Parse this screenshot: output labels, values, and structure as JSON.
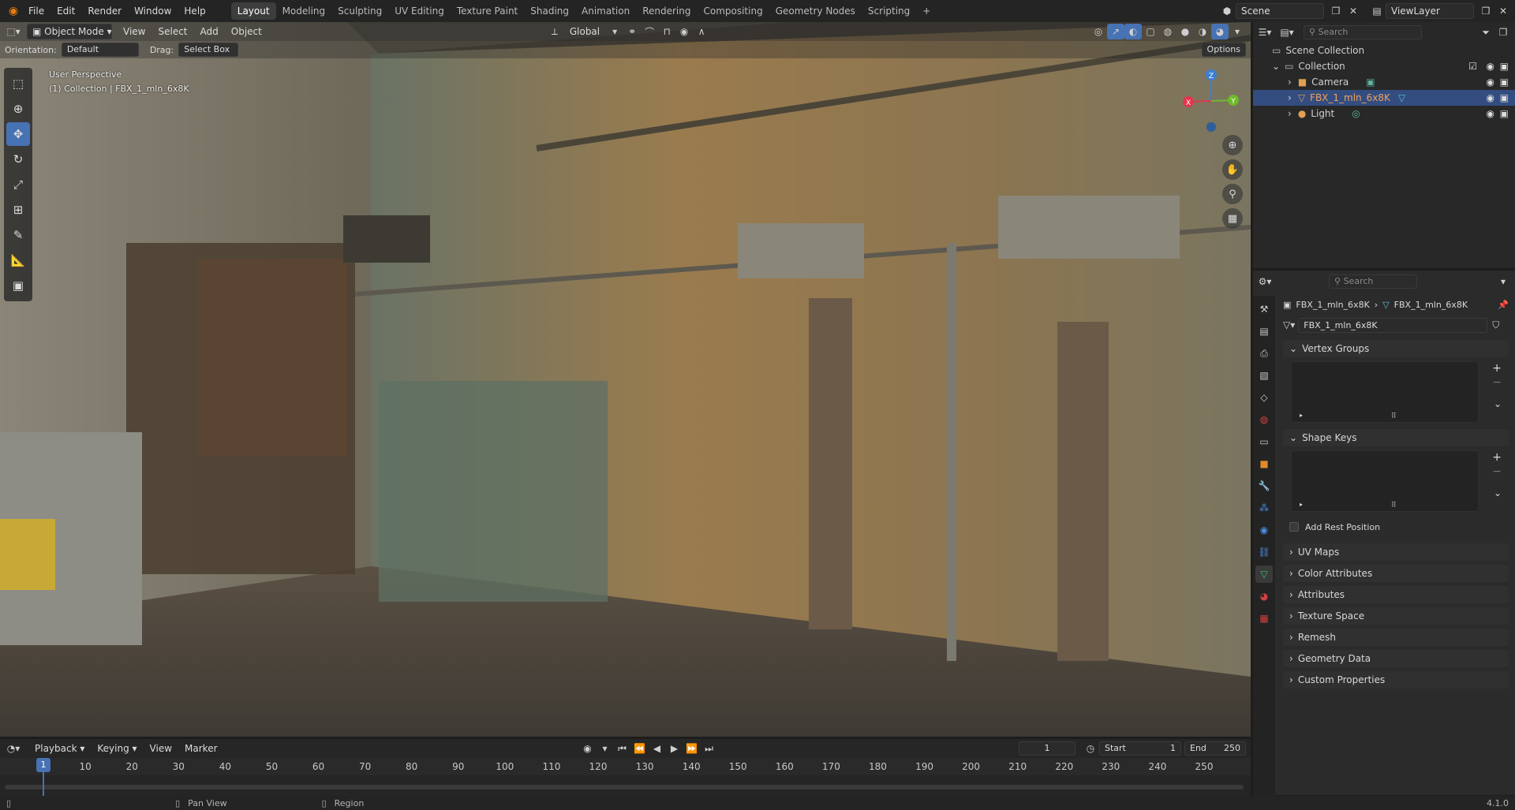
{
  "menu": {
    "items": [
      "File",
      "Edit",
      "Render",
      "Window",
      "Help"
    ]
  },
  "workspaces": {
    "tabs": [
      "Layout",
      "Modeling",
      "Sculpting",
      "UV Editing",
      "Texture Paint",
      "Shading",
      "Animation",
      "Rendering",
      "Compositing",
      "Geometry Nodes",
      "Scripting"
    ],
    "active": "Layout",
    "add_label": "+"
  },
  "scene": {
    "label": "Scene",
    "viewlayer": "ViewLayer"
  },
  "viewport": {
    "mode": "Object Mode",
    "menus": [
      "View",
      "Select",
      "Add",
      "Object"
    ],
    "transform": "Global",
    "orientation_label": "Orientation:",
    "orientation_value": "Default",
    "drag_label": "Drag:",
    "drag_value": "Select Box",
    "options_label": "Options",
    "perspective_text": "User Perspective",
    "collection_text": "(1) Collection | FBX_1_mln_6x8K",
    "gizmo": {
      "x": "X",
      "y": "Y",
      "z": "Z"
    }
  },
  "outliner": {
    "search_placeholder": "Search",
    "rows": [
      {
        "label": "Scene Collection"
      },
      {
        "label": "Collection"
      },
      {
        "label": "Camera"
      },
      {
        "label": "FBX_1_mln_6x8K"
      },
      {
        "label": "Light"
      }
    ]
  },
  "properties": {
    "search_placeholder": "Search",
    "breadcrumb_left": "FBX_1_mln_6x8K",
    "breadcrumb_right": "FBX_1_mln_6x8K",
    "data_name": "FBX_1_mln_6x8K",
    "panels": {
      "vertex_groups": "Vertex Groups",
      "shape_keys": "Shape Keys",
      "add_rest_position": "Add Rest Position",
      "uv_maps": "UV Maps",
      "color_attributes": "Color Attributes",
      "attributes": "Attributes",
      "texture_space": "Texture Space",
      "remesh": "Remesh",
      "geometry_data": "Geometry Data",
      "custom_properties": "Custom Properties"
    }
  },
  "timeline": {
    "menus": [
      "Playback",
      "Keying",
      "View",
      "Marker"
    ],
    "current_frame": "1",
    "start_label": "Start",
    "start_value": "1",
    "end_label": "End",
    "end_value": "250",
    "ticks": [
      "10",
      "20",
      "30",
      "40",
      "50",
      "60",
      "70",
      "80",
      "90",
      "100",
      "110",
      "120",
      "130",
      "140",
      "150",
      "160",
      "170",
      "180",
      "190",
      "200",
      "210",
      "220",
      "230",
      "240",
      "250"
    ],
    "playhead_label": "1"
  },
  "status": {
    "pan": "Pan View",
    "region": "Region",
    "version": "4.1.0"
  },
  "colors": {
    "accent": "#4772b3",
    "selection": "#334d80",
    "header": "#242424",
    "panel": "#2b2b2b",
    "x_axis": "#e0374f",
    "y_axis": "#6fb92b",
    "z_axis": "#3b7fd5"
  }
}
